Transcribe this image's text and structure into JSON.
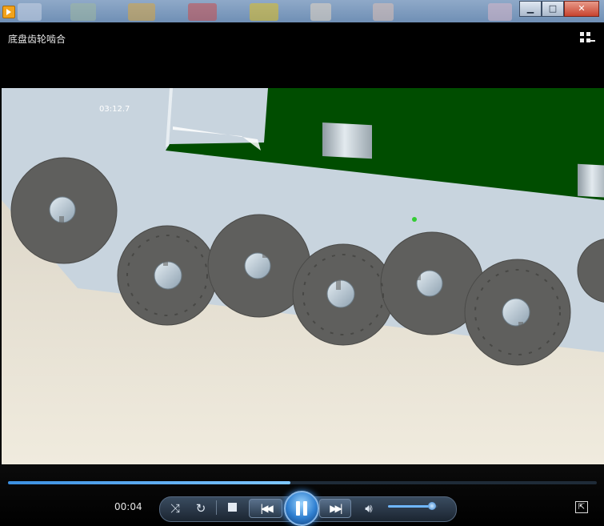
{
  "window": {
    "title": "底盘齿轮啮合",
    "controls": {
      "minimize": "▁",
      "maximize": "□",
      "close": "✕"
    }
  },
  "video": {
    "overlay_text": "03:12.7",
    "scene": {
      "hull_color": "#004d00",
      "ground_color": "#c8d4de",
      "floor_color": "#ebe5d6",
      "wheel_color": "#5f5f5d"
    }
  },
  "player": {
    "elapsed": "00:04",
    "progress": 0.48,
    "volume": 0.88,
    "state": "playing",
    "accent_color": "#3b8fe0"
  },
  "icons": {
    "playlist": "playlist-icon",
    "shuffle": "shuffle-icon",
    "repeat": "repeat-icon",
    "stop": "stop-icon",
    "previous": "previous-icon",
    "pause": "pause-icon",
    "next": "next-icon",
    "volume": "volume-icon",
    "switch_view": "switch-to-library-icon"
  }
}
